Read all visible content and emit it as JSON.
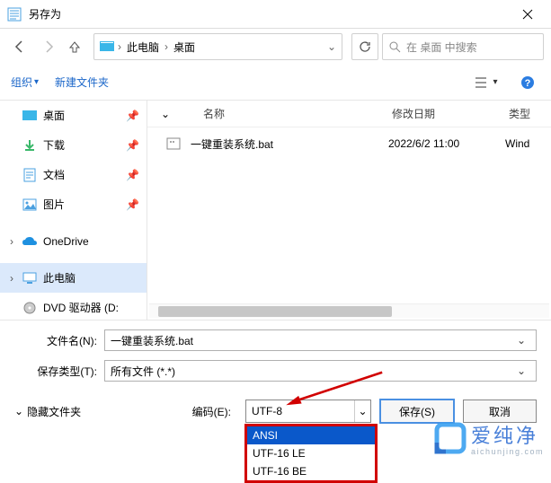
{
  "title": "另存为",
  "breadcrumb": {
    "root": "此电脑",
    "folder": "桌面"
  },
  "search_placeholder": "在 桌面 中搜索",
  "toolbar": {
    "organize": "组织",
    "newfolder": "新建文件夹"
  },
  "sidebar": {
    "items": [
      {
        "label": "桌面",
        "icon": "desktop",
        "pinned": true
      },
      {
        "label": "下载",
        "icon": "download",
        "pinned": true
      },
      {
        "label": "文档",
        "icon": "document",
        "pinned": true
      },
      {
        "label": "图片",
        "icon": "pictures",
        "pinned": true
      },
      {
        "label": "OneDrive",
        "icon": "onedrive"
      },
      {
        "label": "此电脑",
        "icon": "pc",
        "expandable": true,
        "selected": true
      },
      {
        "label": "DVD 驱动器 (D:",
        "icon": "dvd"
      }
    ]
  },
  "columns": {
    "name": "名称",
    "date": "修改日期",
    "type": "类型"
  },
  "files": [
    {
      "name": "一键重装系统.bat",
      "date": "2022/6/2 11:00",
      "type": "Wind"
    }
  ],
  "fields": {
    "filename_label": "文件名(N):",
    "filename_value": "一键重装系统.bat",
    "filetype_label": "保存类型(T):",
    "filetype_value": "所有文件 (*.*)"
  },
  "hide_label": "隐藏文件夹",
  "encoding_label": "编码(E):",
  "encoding_value": "UTF-8",
  "encoding_options": [
    "ANSI",
    "UTF-16 LE",
    "UTF-16 BE"
  ],
  "buttons": {
    "save": "保存(S)",
    "cancel": "取消"
  },
  "watermark": {
    "cn": "爱纯净",
    "en": "aichunjing.com"
  }
}
